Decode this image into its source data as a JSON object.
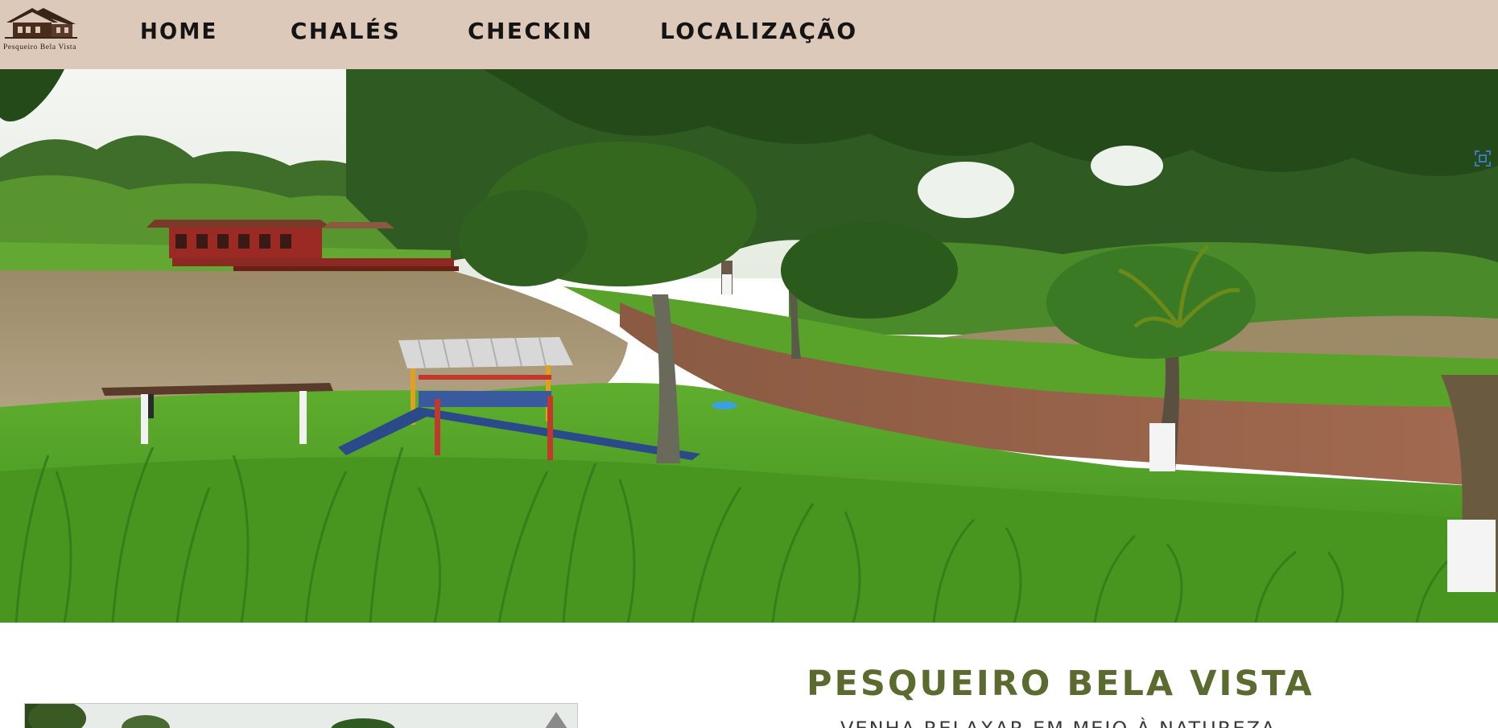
{
  "header": {
    "logo_text": "Pesqueiro Bela Vista",
    "nav": [
      {
        "label": "HOME"
      },
      {
        "label": "CHALÉS"
      },
      {
        "label": "CHECKIN"
      },
      {
        "label": "LOCALIZAÇÃO"
      }
    ]
  },
  "hero": {
    "image_alt": "",
    "fullscreen_icon": "fullscreen-icon"
  },
  "intro": {
    "title": "PESQUEIRO BELA VISTA",
    "subtitle": "Venha relaxar em meio à natureza"
  },
  "colors": {
    "nav_background": "#dcc9b9",
    "title_green": "#5b6b30",
    "nav_text": "#141414"
  }
}
